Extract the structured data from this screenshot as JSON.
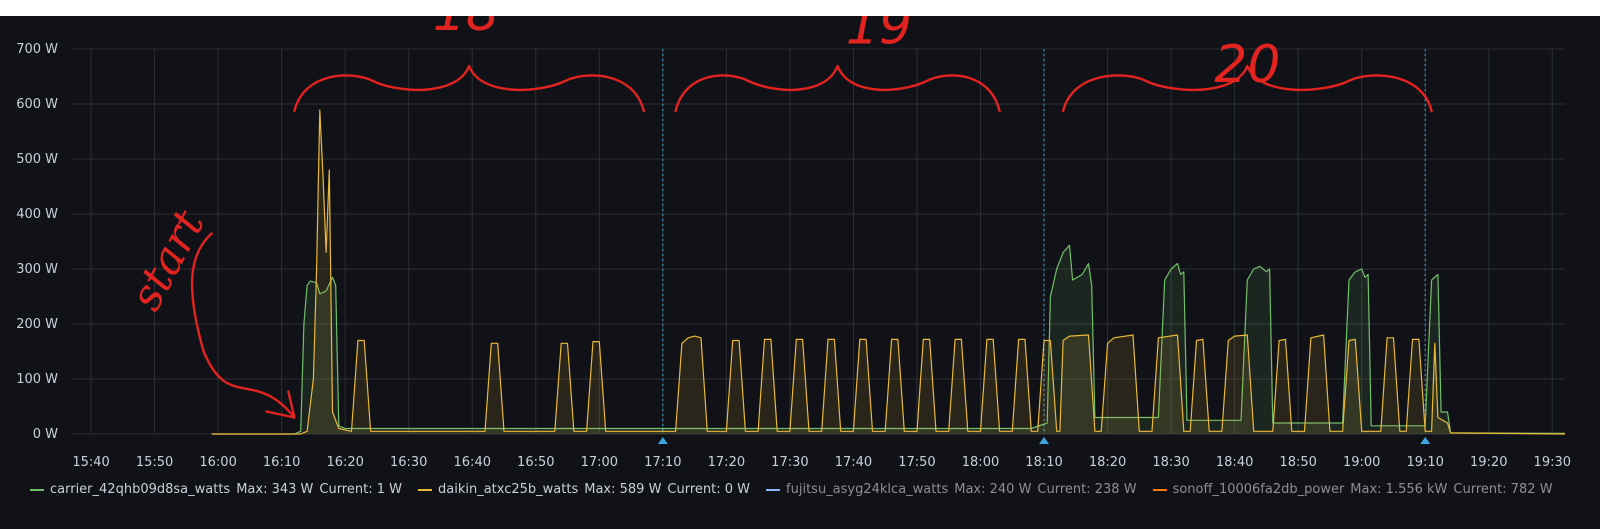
{
  "chart_data": {
    "type": "area",
    "ylabel": "",
    "xlabel": "",
    "ylim": [
      0,
      700
    ],
    "y_unit": "W",
    "y_ticks": [
      "0 W",
      "100 W",
      "200 W",
      "300 W",
      "400 W",
      "500 W",
      "600 W",
      "700 W"
    ],
    "x_ticks": [
      "15:40",
      "15:50",
      "16:00",
      "16:10",
      "16:20",
      "16:30",
      "16:40",
      "16:50",
      "17:00",
      "17:10",
      "17:20",
      "17:30",
      "17:40",
      "17:50",
      "18:00",
      "18:10",
      "18:20",
      "18:30",
      "18:40",
      "18:50",
      "19:00",
      "19:10",
      "19:20",
      "19:30"
    ],
    "xlim": [
      "15:37",
      "19:32"
    ],
    "grid": true,
    "legend_position": "bottom",
    "annotations": [
      {
        "time": "17:10",
        "color": "#3aa7e0"
      },
      {
        "time": "18:10",
        "color": "#3aa7e0"
      },
      {
        "time": "19:10",
        "color": "#3aa7e0"
      }
    ],
    "handwritten_notes": [
      {
        "text": "start",
        "time": "15:53",
        "value": 350
      },
      {
        "text": "18",
        "time": "16:39",
        "value": 735
      },
      {
        "text": "19",
        "time": "17:44",
        "value": 710
      },
      {
        "text": "20",
        "time": "18:42",
        "value": 640
      }
    ],
    "series": [
      {
        "name": "carrier_42qhb09d8sa_watts",
        "color": "#73bf69",
        "stats": {
          "max": "Max: 343 W",
          "current": "Current: 1 W"
        },
        "points": [
          [
            "15:59",
            0
          ],
          [
            "16:12",
            0
          ],
          [
            "16:13",
            5
          ],
          [
            "16:13.5",
            200
          ],
          [
            "16:14",
            270
          ],
          [
            "16:14.5",
            278
          ],
          [
            "16:15.5",
            275
          ],
          [
            "16:16",
            255
          ],
          [
            "16:17",
            260
          ],
          [
            "16:18",
            285
          ],
          [
            "16:18.5",
            270
          ],
          [
            "16:19",
            15
          ],
          [
            "16:20",
            10
          ],
          [
            "18:08",
            10
          ],
          [
            "18:10.5",
            20
          ],
          [
            "18:11",
            250
          ],
          [
            "18:12",
            300
          ],
          [
            "18:13",
            330
          ],
          [
            "18:14",
            343
          ],
          [
            "18:14.5",
            280
          ],
          [
            "18:16",
            290
          ],
          [
            "18:17",
            310
          ],
          [
            "18:17.5",
            270
          ],
          [
            "18:18",
            30
          ],
          [
            "18:28",
            30
          ],
          [
            "18:29",
            280
          ],
          [
            "18:30",
            300
          ],
          [
            "18:31",
            310
          ],
          [
            "18:31.5",
            290
          ],
          [
            "18:32",
            295
          ],
          [
            "18:32.5",
            25
          ],
          [
            "18:41",
            25
          ],
          [
            "18:42",
            280
          ],
          [
            "18:43",
            300
          ],
          [
            "18:44",
            305
          ],
          [
            "18:45",
            295
          ],
          [
            "18:45.5",
            300
          ],
          [
            "18:46",
            20
          ],
          [
            "18:57",
            20
          ],
          [
            "18:58",
            280
          ],
          [
            "18:59",
            295
          ],
          [
            "19:00",
            300
          ],
          [
            "19:00.5",
            285
          ],
          [
            "19:01",
            290
          ],
          [
            "19:01.5",
            15
          ],
          [
            "19:10",
            15
          ],
          [
            "19:10.5",
            150
          ],
          [
            "19:11",
            280
          ],
          [
            "19:12",
            290
          ],
          [
            "19:12.5",
            40
          ],
          [
            "19:13.5",
            40
          ],
          [
            "19:14",
            2
          ],
          [
            "19:32",
            1
          ]
        ]
      },
      {
        "name": "daikin_atxc25b_watts",
        "color": "#eab839",
        "stats": {
          "max": "Max: 589 W",
          "current": "Current: 0 W"
        },
        "points": [
          [
            "15:59",
            0
          ],
          [
            "16:13",
            0
          ],
          [
            "16:14",
            5
          ],
          [
            "16:15",
            100
          ],
          [
            "16:15.5",
            300
          ],
          [
            "16:16",
            589
          ],
          [
            "16:16.5",
            470
          ],
          [
            "16:17",
            330
          ],
          [
            "16:17.5",
            480
          ],
          [
            "16:18",
            40
          ],
          [
            "16:19",
            10
          ],
          [
            "16:21",
            5
          ],
          [
            "16:22",
            170
          ],
          [
            "16:23",
            170
          ],
          [
            "16:24",
            5
          ],
          [
            "16:42",
            5
          ],
          [
            "16:43",
            165
          ],
          [
            "16:44",
            165
          ],
          [
            "16:45",
            5
          ],
          [
            "16:53",
            5
          ],
          [
            "16:54",
            165
          ],
          [
            "16:55",
            165
          ],
          [
            "16:56",
            5
          ],
          [
            "16:58",
            5
          ],
          [
            "16:59",
            168
          ],
          [
            "17:00",
            168
          ],
          [
            "17:01",
            5
          ],
          [
            "17:12",
            5
          ],
          [
            "17:13",
            165
          ],
          [
            "17:14",
            175
          ],
          [
            "17:15",
            178
          ],
          [
            "17:16",
            175
          ],
          [
            "17:17",
            5
          ],
          [
            "17:20",
            5
          ],
          [
            "17:21",
            170
          ],
          [
            "17:22",
            170
          ],
          [
            "17:23",
            5
          ],
          [
            "17:25",
            5
          ],
          [
            "17:26",
            172
          ],
          [
            "17:27",
            172
          ],
          [
            "17:28",
            5
          ],
          [
            "17:30",
            5
          ],
          [
            "17:31",
            172
          ],
          [
            "17:32",
            172
          ],
          [
            "17:33",
            5
          ],
          [
            "17:35",
            5
          ],
          [
            "17:36",
            172
          ],
          [
            "17:37",
            172
          ],
          [
            "17:38",
            5
          ],
          [
            "17:40",
            5
          ],
          [
            "17:41",
            172
          ],
          [
            "17:42",
            172
          ],
          [
            "17:43",
            5
          ],
          [
            "17:45",
            5
          ],
          [
            "17:46",
            172
          ],
          [
            "17:47",
            172
          ],
          [
            "17:48",
            5
          ],
          [
            "17:50",
            5
          ],
          [
            "17:51",
            172
          ],
          [
            "17:52",
            172
          ],
          [
            "17:53",
            5
          ],
          [
            "17:55",
            5
          ],
          [
            "17:56",
            172
          ],
          [
            "17:57",
            172
          ],
          [
            "17:58",
            5
          ],
          [
            "18:00",
            5
          ],
          [
            "18:01",
            172
          ],
          [
            "18:02",
            172
          ],
          [
            "18:03",
            5
          ],
          [
            "18:05",
            5
          ],
          [
            "18:06",
            172
          ],
          [
            "18:07",
            172
          ],
          [
            "18:08",
            5
          ],
          [
            "18:09",
            5
          ],
          [
            "18:10",
            170
          ],
          [
            "18:11",
            170
          ],
          [
            "18:12",
            5
          ],
          [
            "18:12.5",
            5
          ],
          [
            "18:13",
            170
          ],
          [
            "18:14",
            178
          ],
          [
            "18:17",
            180
          ],
          [
            "18:18",
            5
          ],
          [
            "18:19",
            5
          ],
          [
            "18:20",
            165
          ],
          [
            "18:21",
            175
          ],
          [
            "18:24",
            180
          ],
          [
            "18:25",
            5
          ],
          [
            "18:27",
            5
          ],
          [
            "18:28",
            175
          ],
          [
            "18:31",
            180
          ],
          [
            "18:32",
            5
          ],
          [
            "18:33",
            5
          ],
          [
            "18:34",
            170
          ],
          [
            "18:35",
            172
          ],
          [
            "18:36",
            5
          ],
          [
            "18:38",
            5
          ],
          [
            "18:39",
            170
          ],
          [
            "18:40",
            178
          ],
          [
            "18:42",
            180
          ],
          [
            "18:43",
            5
          ],
          [
            "18:46",
            5
          ],
          [
            "18:47",
            170
          ],
          [
            "18:48",
            172
          ],
          [
            "18:49",
            5
          ],
          [
            "18:51",
            5
          ],
          [
            "18:52",
            175
          ],
          [
            "18:54",
            180
          ],
          [
            "18:55",
            5
          ],
          [
            "18:57",
            5
          ],
          [
            "18:58",
            170
          ],
          [
            "18:59",
            172
          ],
          [
            "19:00",
            5
          ],
          [
            "19:03",
            5
          ],
          [
            "19:04",
            175
          ],
          [
            "19:05",
            175
          ],
          [
            "19:06",
            5
          ],
          [
            "19:07",
            5
          ],
          [
            "19:08",
            172
          ],
          [
            "19:09",
            172
          ],
          [
            "19:10",
            5
          ],
          [
            "19:11",
            5
          ],
          [
            "19:11.5",
            165
          ],
          [
            "19:12",
            30
          ],
          [
            "19:13.5",
            20
          ],
          [
            "19:14",
            2
          ],
          [
            "19:32",
            0
          ]
        ]
      },
      {
        "name": "fujitsu_asyg24klca_watts",
        "color": "#8ab8ff",
        "muted": true,
        "stats": {
          "max": "Max: 240 W",
          "current": "Current: 238 W"
        },
        "points": []
      },
      {
        "name": "sonoff_10006fa2db_power",
        "color": "#ff780a",
        "muted": true,
        "stats": {
          "max": "Max: 1.556 kW",
          "current": "Current: 782 W"
        },
        "points": []
      }
    ]
  }
}
